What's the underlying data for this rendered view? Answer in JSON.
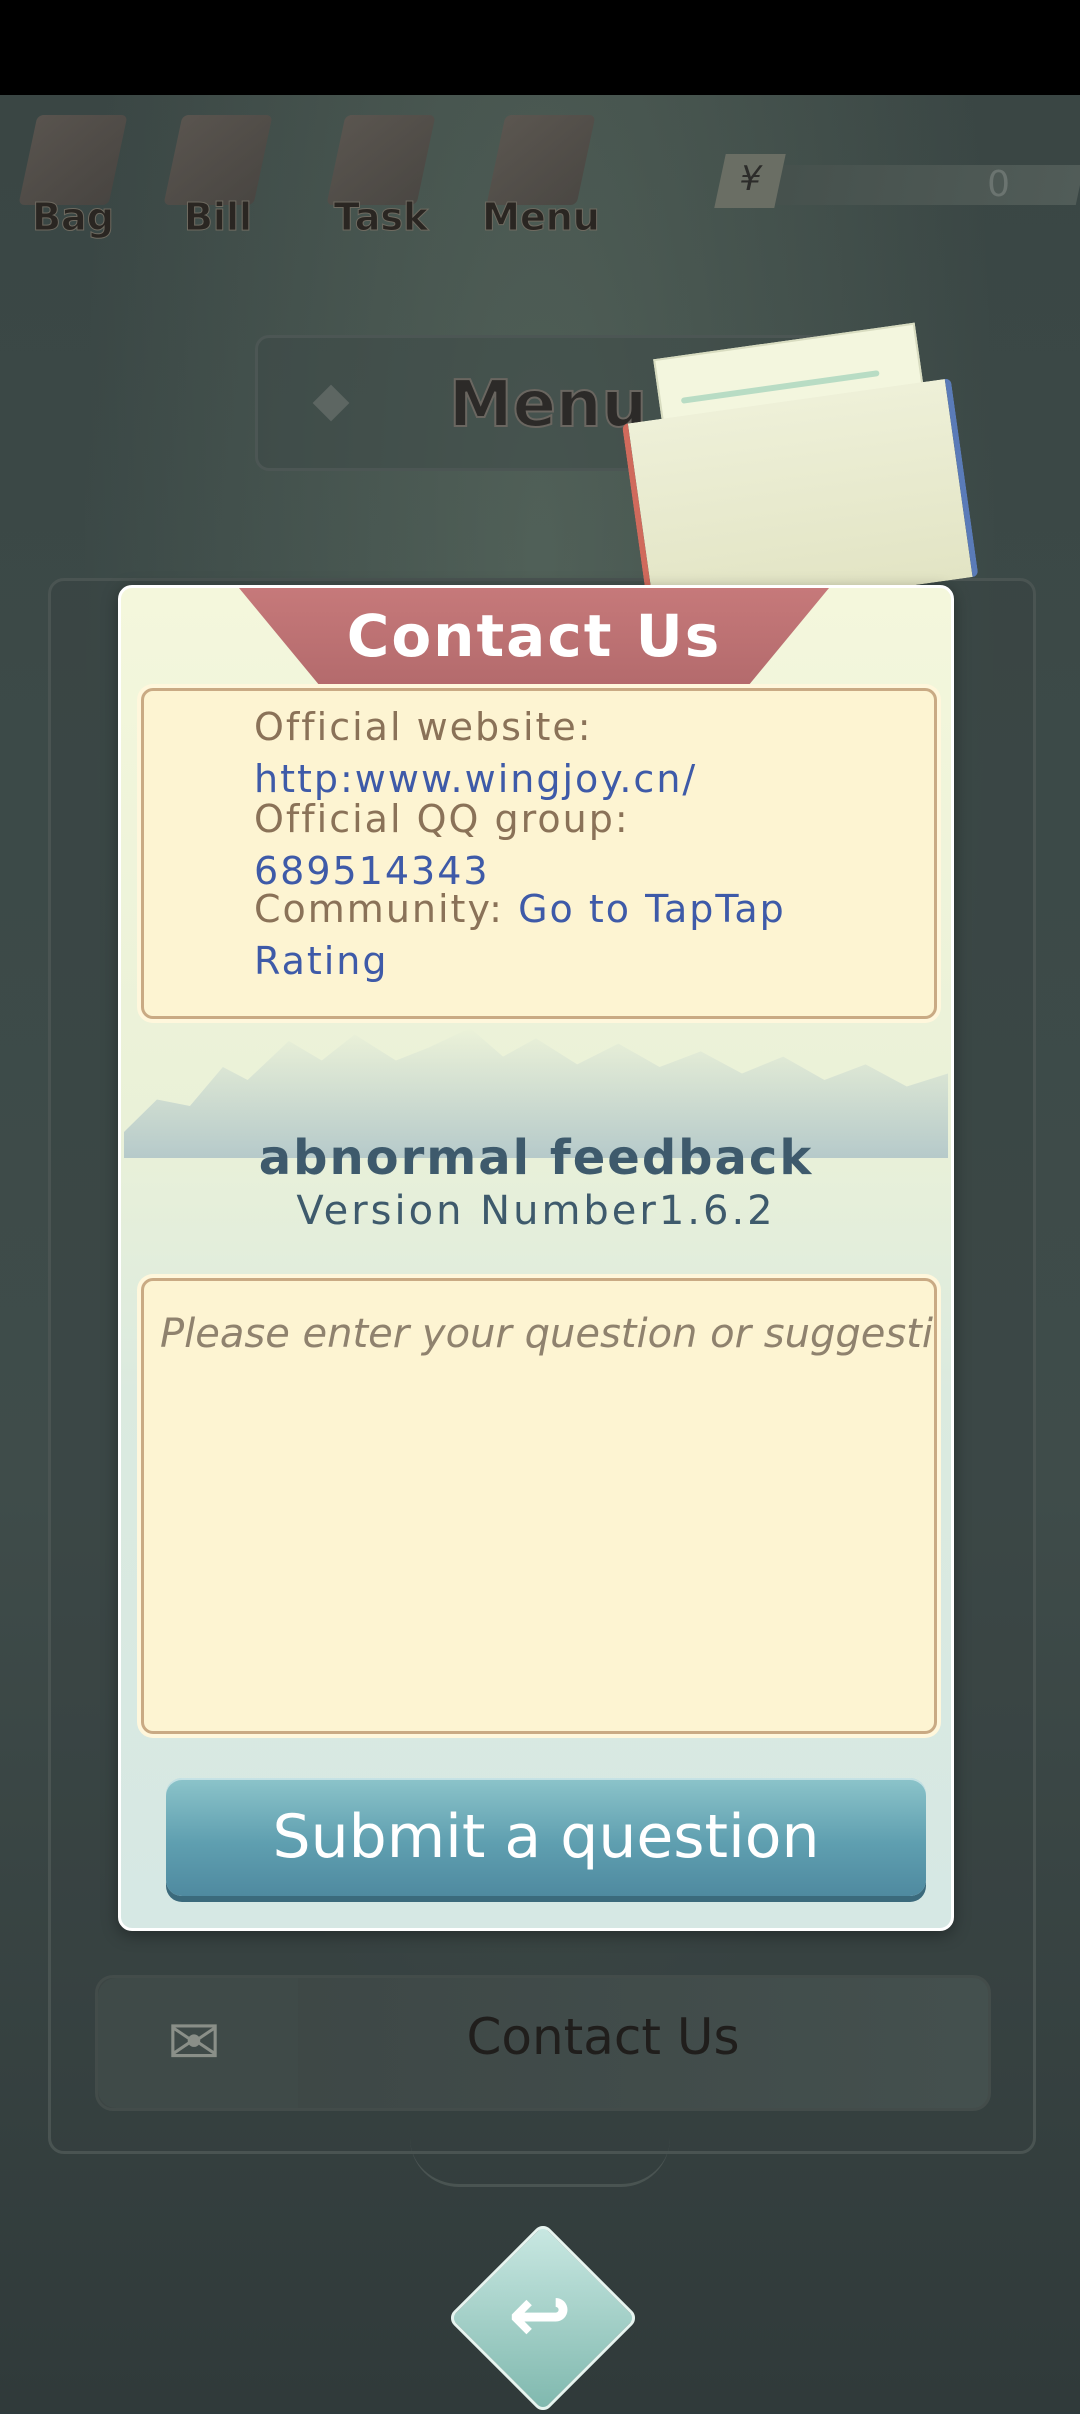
{
  "nav": {
    "items": [
      {
        "label": "Bag",
        "icon": "bag-icon"
      },
      {
        "label": "Bill",
        "icon": "bill-icon"
      },
      {
        "label": "Task",
        "icon": "task-icon"
      },
      {
        "label": "Menu",
        "icon": "menu-icon"
      }
    ],
    "currency_symbol": "¥",
    "currency_value": "0"
  },
  "menu": {
    "title": "Menu",
    "contact_row_label": "Contact Us"
  },
  "dialog": {
    "title": "Contact Us",
    "website_label": "Official website:",
    "website_value": "http:www.wingjoy.cn/",
    "qq_label": "Official QQ group:",
    "qq_value": "689514343",
    "community_label": "Community:",
    "community_link_line1": "Go to TapTap",
    "community_link_line2": "Rating",
    "feedback_title": "abnormal feedback",
    "version": "Version Number1.6.2",
    "input_placeholder": "Please enter your question or suggestion",
    "submit_label": "Submit a question"
  },
  "colors": {
    "ribbon": "#c6797a",
    "link": "#3e5aa8",
    "label": "#8a7258",
    "submit": "#5f9fb0"
  }
}
